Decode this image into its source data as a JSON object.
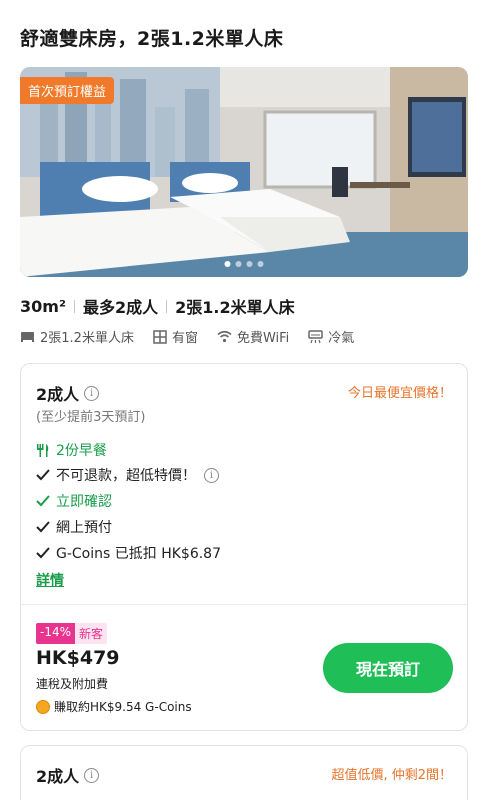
{
  "room": {
    "title": "舒適雙床房，2張1.2米單人床",
    "promo_tag": "首次預訂權益",
    "carousel": {
      "count": 4,
      "active_index": 0
    },
    "specs": {
      "size": "30m²",
      "occupancy": "最多2成人",
      "beds": "2張1.2米單人床"
    },
    "amenities": [
      {
        "icon": "bed-icon",
        "label": "2張1.2米單人床"
      },
      {
        "icon": "window-icon",
        "label": "有窗"
      },
      {
        "icon": "wifi-icon",
        "label": "免費WiFi"
      },
      {
        "icon": "air-conditioner-icon",
        "label": "冷氣"
      }
    ]
  },
  "offers": [
    {
      "persons": "2成人",
      "deal_label": "今日最便宜價格！",
      "advance": "(至少提前3天預訂)",
      "breakfast": "2份早餐",
      "features": {
        "non_refundable": "不可退款，超低特價！",
        "instant_confirm": "立即確認",
        "online_pay": "網上預付",
        "gcoins": "G-Coins 已抵扣 HK$6.87"
      },
      "details_link": "詳情",
      "discount": "-14%",
      "new_customer": "新客",
      "price": "HK$479",
      "tax_note": "連稅及附加費",
      "earn_coins": "賺取約HK$9.54 G-Coins",
      "book_button": "現在預訂"
    },
    {
      "persons": "2成人",
      "deal_label": "超值低價, 仲剩2間！"
    }
  ],
  "colors": {
    "accent_green": "#1fbe57",
    "green_text": "#1a9d4b",
    "orange": "#e8742b",
    "pink": "#e8338f"
  }
}
